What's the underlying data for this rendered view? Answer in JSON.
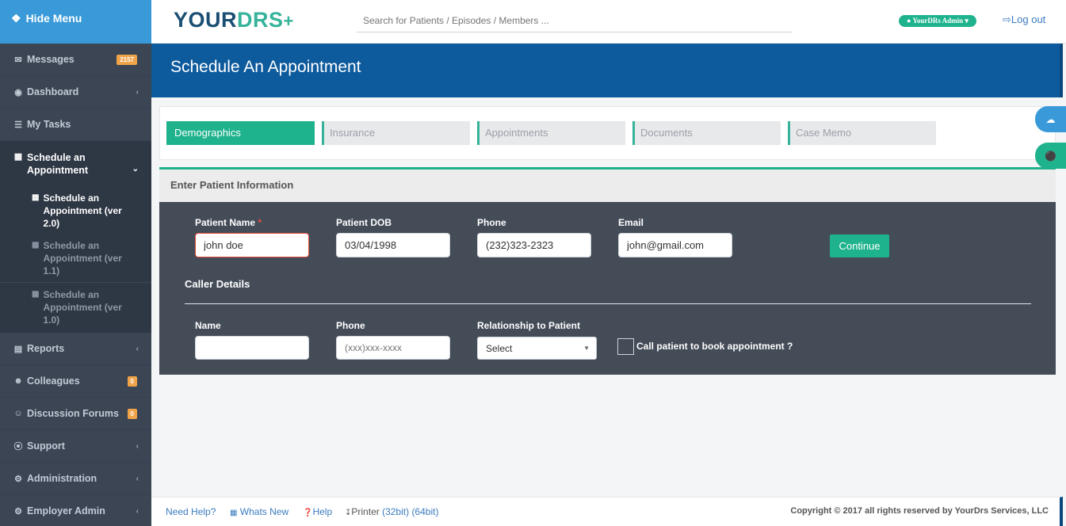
{
  "sidebar": {
    "hide_menu": "Hide Menu",
    "items": [
      {
        "label": "Messages",
        "badge": "2157",
        "icon": "envelope-icon"
      },
      {
        "label": "Dashboard",
        "icon": "dashboard-icon"
      },
      {
        "label": "My Tasks",
        "icon": "list-icon"
      },
      {
        "label": "Schedule an Appointment",
        "icon": "document-icon"
      },
      {
        "label": "Reports",
        "icon": "bar-chart-icon"
      },
      {
        "label": "Colleagues",
        "badge": "0",
        "icon": "users-icon"
      },
      {
        "label": "Discussion Forums",
        "badge": "0",
        "icon": "smile-icon"
      },
      {
        "label": "Support",
        "icon": "lifebuoy-icon"
      },
      {
        "label": "Administration",
        "icon": "gear-icon"
      },
      {
        "label": "Employer Admin",
        "icon": "gear-icon"
      }
    ],
    "sub_items": [
      {
        "label": "Schedule an Appointment (ver 2.0)"
      },
      {
        "label": "Schedule an Appointment (ver 1.1)"
      },
      {
        "label": "Schedule an Appointment (ver 1.0)"
      }
    ]
  },
  "topbar": {
    "logo_part1": "YOUR",
    "logo_part2": "DRS",
    "search_placeholder": "Search for Patients / Episodes / Members ...",
    "admin_label": "YourDRs Admin",
    "logout": "Log out"
  },
  "header": {
    "title": "Schedule An Appointment"
  },
  "tabs": [
    {
      "label": "Demographics",
      "active": true
    },
    {
      "label": "Insurance"
    },
    {
      "label": "Appointments"
    },
    {
      "label": "Documents"
    },
    {
      "label": "Case Memo"
    }
  ],
  "panel": {
    "heading": "Enter Patient Information",
    "patient": {
      "name_label": "Patient Name",
      "required_mark": "*",
      "name_value": "john doe",
      "dob_label": "Patient DOB",
      "dob_value": "03/04/1998",
      "phone_label": "Phone",
      "phone_value": "(232)323-2323",
      "email_label": "Email",
      "email_value": "john@gmail.com",
      "continue": "Continue"
    },
    "caller": {
      "title": "Caller Details",
      "name_label": "Name",
      "name_value": "",
      "phone_label": "Phone",
      "phone_placeholder": "(xxx)xxx-xxxx",
      "relationship_label": "Relationship to Patient",
      "relationship_value": "Select",
      "call_label": "Call patient to book appointment ?"
    }
  },
  "footer": {
    "need_help": "Need Help?",
    "whats_new": "Whats New",
    "help": "Help",
    "printer": "Printer",
    "printer_32": "(32bit)",
    "printer_64": "(64bit)",
    "copyright": "Copyright © 2017 all rights reserved by YourDrs Services, LLC"
  },
  "colors": {
    "accent_green": "#1fb38d",
    "header_blue": "#0d5a9c",
    "sidebar_bg": "#3b4554",
    "badge_orange": "#f0a44a"
  }
}
